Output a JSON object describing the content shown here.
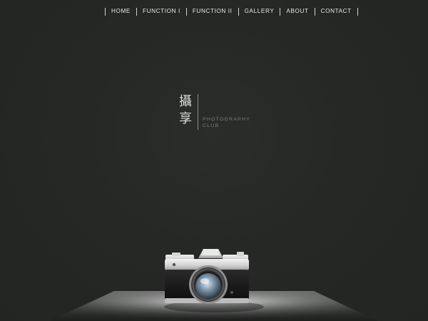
{
  "nav": {
    "items": [
      {
        "label": "HOME"
      },
      {
        "label": "FUNCTION I"
      },
      {
        "label": "FUNCTION II"
      },
      {
        "label": "GALLERY"
      },
      {
        "label": "ABOUT"
      },
      {
        "label": "CONTACT"
      }
    ]
  },
  "logo": {
    "chinese_line1": "攝",
    "chinese_line2": "享",
    "english_line1": "PHOTOGRAPHY",
    "english_line2": "CLUB"
  },
  "colors": {
    "background": "#252725",
    "nav_text": "#e8e8e8",
    "logo_text": "#dcdcdc",
    "logo_subtext": "#7d7d7d"
  },
  "icons": {
    "hero": "camera-illustration"
  }
}
